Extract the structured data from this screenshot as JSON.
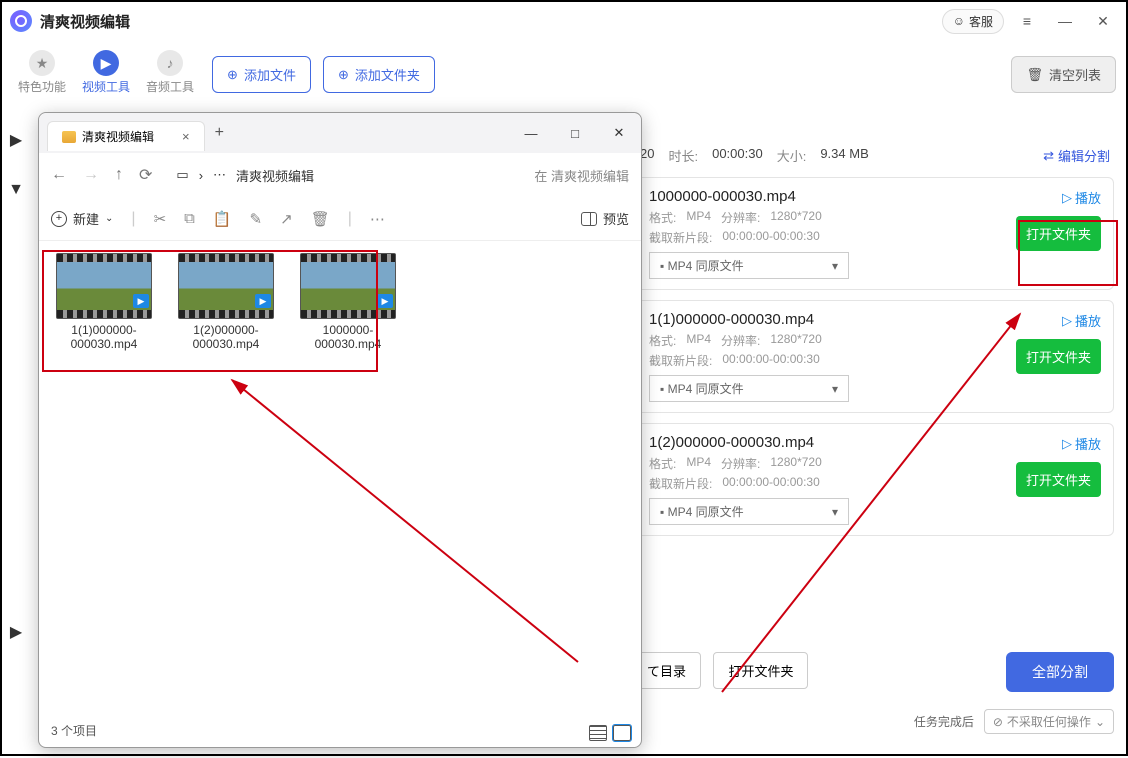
{
  "app": {
    "title": "清爽视频编辑",
    "support": "客服"
  },
  "toolbar": {
    "tabs": {
      "special": "特色功能",
      "video": "视频工具",
      "audio": "音频工具"
    },
    "add_file": "添加文件",
    "add_folder": "添加文件夹",
    "clear": "清空列表"
  },
  "info_header": {
    "res_sfx": "20",
    "duration_lbl": "时长:",
    "duration": "00:00:30",
    "size_lbl": "大小:",
    "size": "9.34 MB",
    "edit_split": "编辑分割"
  },
  "results": [
    {
      "name": "1000000-000030.mp4",
      "fmt_lbl": "格式:",
      "fmt": "MP4",
      "res_lbl": "分辨率:",
      "res": "1280*720",
      "clip_lbl": "截取新片段:",
      "clip": "00:00:00-00:00:30",
      "select_label": "MP4  同原文件",
      "play": "播放",
      "open": "打开文件夹"
    },
    {
      "name": "1(1)000000-000030.mp4",
      "fmt_lbl": "格式:",
      "fmt": "MP4",
      "res_lbl": "分辨率:",
      "res": "1280*720",
      "clip_lbl": "截取新片段:",
      "clip": "00:00:00-00:00:30",
      "select_label": "MP4  同原文件",
      "play": "播放",
      "open": "打开文件夹"
    },
    {
      "name": "1(2)000000-000030.mp4",
      "fmt_lbl": "格式:",
      "fmt": "MP4",
      "res_lbl": "分辨率:",
      "res": "1280*720",
      "clip_lbl": "截取新片段:",
      "clip": "00:00:00-00:00:30",
      "select_label": "MP4  同原文件",
      "play": "播放",
      "open": "打开文件夹"
    }
  ],
  "bottom": {
    "dir_btn": "て目录",
    "open_folder": "打开文件夹",
    "split_all": "全部分割",
    "after_lbl": "任务完成后",
    "after_opt": "不采取任何操作"
  },
  "explorer": {
    "tab": "清爽视频编辑",
    "path_current": "清爽视频编辑",
    "search_hint": "在 清爽视频编辑",
    "new_btn": "新建",
    "preview": "预览",
    "files": [
      "1(1)000000-000030.mp4",
      "1(2)000000-000030.mp4",
      "1000000-000030.mp4"
    ],
    "status": "3 个项目"
  }
}
